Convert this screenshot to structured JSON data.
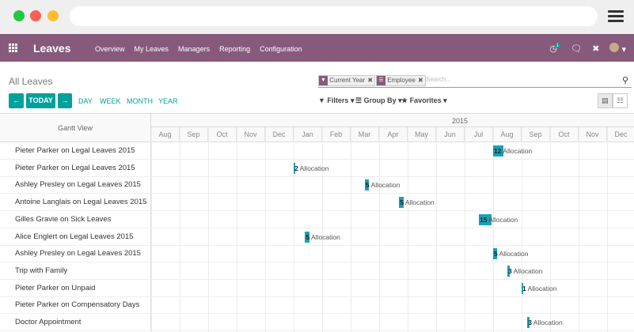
{
  "navbar": {
    "brand": "Leaves",
    "menu": [
      "Overview",
      "My Leaves",
      "Managers",
      "Reporting",
      "Configuration"
    ],
    "badge": "1"
  },
  "control_panel": {
    "title": "All Leaves",
    "today_label": "TODAY",
    "scales": [
      "DAY",
      "WEEK",
      "MONTH",
      "YEAR"
    ],
    "facets": [
      {
        "label": "Current Year",
        "icon": "filter-icon"
      },
      {
        "label": "Employee",
        "icon": "list-icon"
      }
    ],
    "search_placeholder": "Search...",
    "filters_label": "Filters",
    "group_by_label": "Group By",
    "favorites_label": "Favorites"
  },
  "gantt": {
    "left_header": "Gantt View",
    "year": "2015",
    "months": [
      "Aug",
      "Sep",
      "Oct",
      "Nov",
      "Dec",
      "Jan",
      "Feb",
      "Mar",
      "Apr",
      "May",
      "Jun",
      "Jul",
      "Aug",
      "Sep",
      "Oct",
      "Nov",
      "Dec"
    ],
    "rows": [
      {
        "label": "Pieter Parker on Legal Leaves 2015",
        "month_index": 12.0,
        "fraction_width": 0.35,
        "count": "12",
        "text": "Allocation"
      },
      {
        "label": "Pieter Parker on Legal Leaves 2015",
        "month_index": 5.0,
        "fraction_width": 0.05,
        "count": "2",
        "text": "Allocation"
      },
      {
        "label": "Ashley Presley on Legal Leaves 2015",
        "month_index": 7.5,
        "fraction_width": 0.15,
        "count": "5",
        "text": "Allocation"
      },
      {
        "label": "Antoine Langlais on Legal Leaves 2015",
        "month_index": 8.7,
        "fraction_width": 0.15,
        "count": "5",
        "text": "Allocation"
      },
      {
        "label": "Gilles Gravie on Sick Leaves",
        "month_index": 11.5,
        "fraction_width": 0.45,
        "count": "15",
        "text": "Allocation"
      },
      {
        "label": "Alice Englert on Legal Leaves 2015",
        "month_index": 5.4,
        "fraction_width": 0.15,
        "count": "5",
        "text": "Allocation"
      },
      {
        "label": "Ashley Presley on Legal Leaves 2015",
        "month_index": 12.0,
        "fraction_width": 0.15,
        "count": "5",
        "text": "Allocation"
      },
      {
        "label": "Trip with Family",
        "month_index": 12.5,
        "fraction_width": 0.08,
        "count": "3",
        "text": "Allocation"
      },
      {
        "label": "Pieter Parker on Unpaid",
        "month_index": 13.0,
        "fraction_width": 0.05,
        "count": "1",
        "text": "Allocation"
      },
      {
        "label": "Pieter Parker on Compensatory Days",
        "month_index": null,
        "fraction_width": 0,
        "count": "",
        "text": ""
      },
      {
        "label": "Doctor Appointment",
        "month_index": 13.2,
        "fraction_width": 0.08,
        "count": "3",
        "text": "Allocation"
      }
    ]
  },
  "colors": {
    "navbar": "#875a7b",
    "accent": "#00a09d",
    "bar": "#17a2b8"
  }
}
